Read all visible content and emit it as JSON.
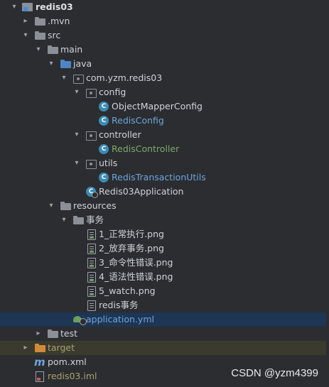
{
  "tree": {
    "root": "redis03",
    "mvn": ".mvn",
    "src": "src",
    "main": "main",
    "java": "java",
    "package": "com.yzm.redis03",
    "config": "config",
    "object_mapper_config": "ObjectMapperConfig",
    "redis_config": "RedisConfig",
    "controller": "controller",
    "redis_controller": "RedisController",
    "utils": "utils",
    "redis_transaction_utils": "RedisTransactionUtils",
    "application_class": "Redis03Application",
    "resources": "resources",
    "transaction_folder": "事务",
    "files": [
      "1_正常执行.png",
      "2_放弃事务.png",
      "3_命令性错误.png",
      "4_语法性错误.png",
      "5_watch.png",
      "redis事务"
    ],
    "application_yml": "application.yml",
    "test": "test",
    "target": "target",
    "pom": "pom.xml",
    "iml": "redis03.iml"
  },
  "watermark": "CSDN @yzm4399",
  "colors": {
    "background": "#2b2d30",
    "selected_row": "#1e3553",
    "class_icon": "#3b8bb5",
    "folder": "#8a8f98",
    "source_folder": "#4e85c6",
    "excluded_folder": "#d08a3a"
  },
  "icons": {
    "folder": "folder-icon",
    "package": "package-icon",
    "class": "class-icon",
    "file": "file-icon",
    "image": "image-file-icon",
    "yml": "yml-icon",
    "maven": "maven-icon",
    "iml": "iml-icon",
    "module": "module-icon"
  }
}
